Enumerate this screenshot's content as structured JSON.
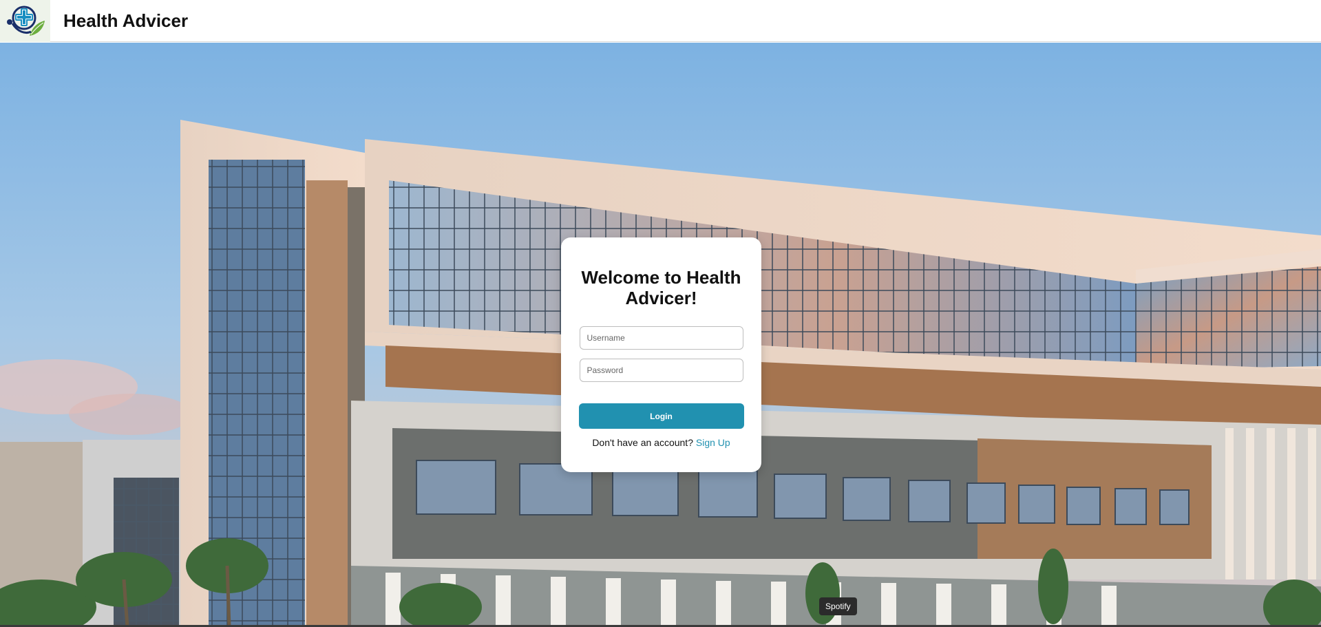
{
  "header": {
    "title": "Health Advicer",
    "logo_icon": "medical-cross-stethoscope-leaf-icon"
  },
  "login": {
    "title": "Welcome to Health Advicer!",
    "username_placeholder": "Username",
    "password_placeholder": "Password",
    "login_label": "Login",
    "signup_prompt": "Don't have an account?",
    "signup_link": "Sign Up"
  },
  "tooltip": {
    "text": "Spotify"
  },
  "colors": {
    "accent": "#2191b0",
    "logo_blue": "#1a8fc1",
    "logo_green": "#6cae3e"
  }
}
